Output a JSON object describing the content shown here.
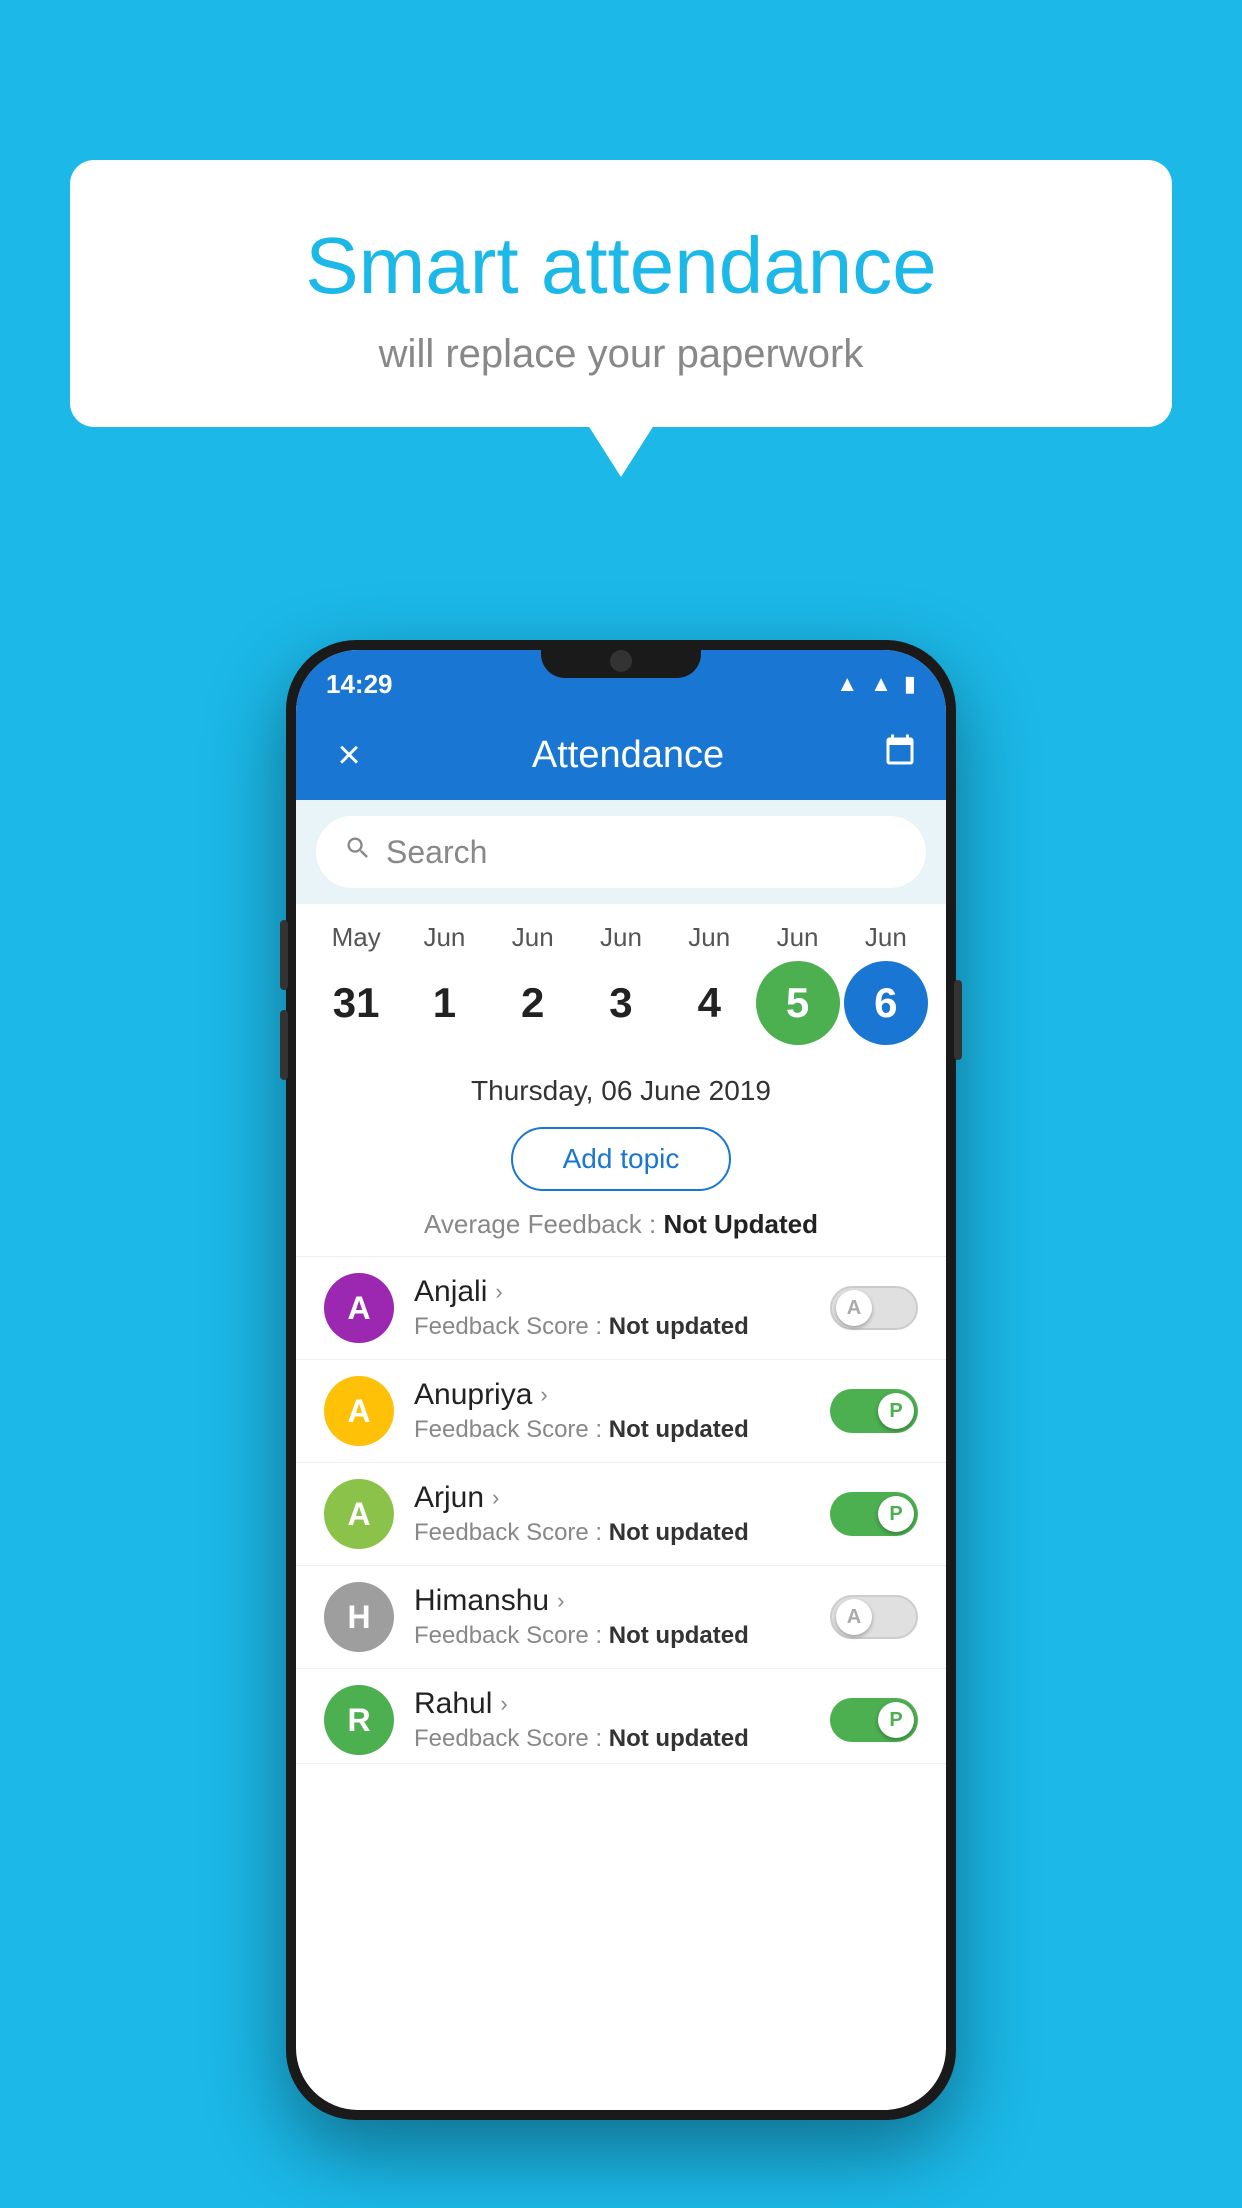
{
  "background_color": "#1BB8E8",
  "bubble": {
    "title": "Smart attendance",
    "subtitle": "will replace your paperwork"
  },
  "status_bar": {
    "time": "14:29",
    "icons": [
      "wifi",
      "signal",
      "battery"
    ]
  },
  "app_bar": {
    "close_label": "×",
    "title": "Attendance",
    "calendar_icon": "📅"
  },
  "search": {
    "placeholder": "Search"
  },
  "calendar": {
    "months": [
      "May",
      "Jun",
      "Jun",
      "Jun",
      "Jun",
      "Jun",
      "Jun"
    ],
    "dates": [
      "31",
      "1",
      "2",
      "3",
      "4",
      "5",
      "6"
    ],
    "today_index": 5,
    "selected_index": 6
  },
  "selected_date": "Thursday, 06 June 2019",
  "add_topic_label": "Add topic",
  "avg_feedback_label": "Average Feedback :",
  "avg_feedback_value": "Not Updated",
  "students": [
    {
      "name": "Anjali",
      "avatar_letter": "A",
      "avatar_color": "#9C27B0",
      "feedback_label": "Feedback Score :",
      "feedback_value": "Not updated",
      "toggle_state": "off",
      "toggle_label": "A"
    },
    {
      "name": "Anupriya",
      "avatar_letter": "A",
      "avatar_color": "#FFC107",
      "feedback_label": "Feedback Score :",
      "feedback_value": "Not updated",
      "toggle_state": "on",
      "toggle_label": "P"
    },
    {
      "name": "Arjun",
      "avatar_letter": "A",
      "avatar_color": "#8BC34A",
      "feedback_label": "Feedback Score :",
      "feedback_value": "Not updated",
      "toggle_state": "on",
      "toggle_label": "P"
    },
    {
      "name": "Himanshu",
      "avatar_letter": "H",
      "avatar_color": "#9E9E9E",
      "feedback_label": "Feedback Score :",
      "feedback_value": "Not updated",
      "toggle_state": "off",
      "toggle_label": "A"
    },
    {
      "name": "Rahul",
      "avatar_letter": "R",
      "avatar_color": "#4CAF50",
      "feedback_label": "Feedback Score :",
      "feedback_value": "Not updated",
      "toggle_state": "on",
      "toggle_label": "P"
    }
  ]
}
